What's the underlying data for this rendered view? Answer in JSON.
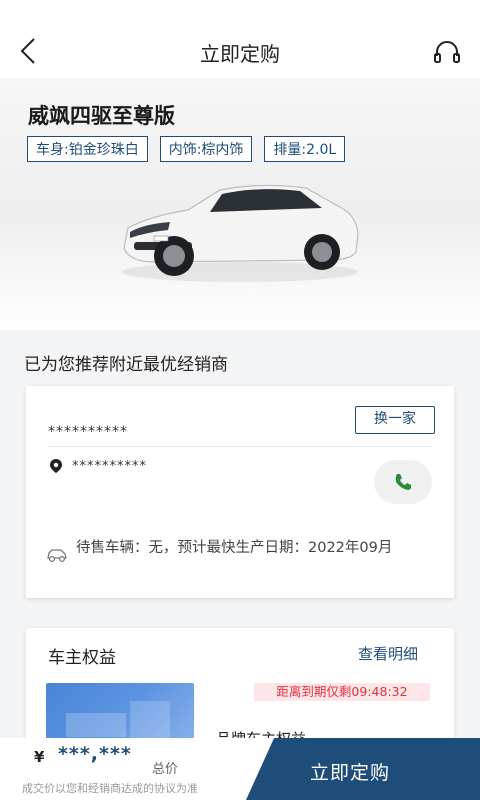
{
  "header": {
    "title": "立即定购",
    "back_icon": "chevron-left-icon",
    "support_icon": "headset-icon"
  },
  "car": {
    "model": "威飒四驱至尊版",
    "specs": [
      "车身:铂金珍珠白",
      "内饰:棕内饰",
      "排量:2.0L"
    ],
    "body_color": "#f4f4f4"
  },
  "dealer_section": {
    "title": "已为您推荐附近最优经销商",
    "switch_label": "换一家",
    "dealer_name": "**********",
    "dealer_address": "**********",
    "stock_text": "待售车辆：无，预计最快生产日期：2022年09月"
  },
  "benefits": {
    "title": "车主权益",
    "detail_link": "查看明细",
    "countdown": "距离到期仅剩09:48:32",
    "item_label": "品牌车主权益"
  },
  "footer": {
    "currency": "¥",
    "price": "***,***",
    "price_label": "总价",
    "note": "成交价以您和经销商达成的协议为准",
    "order_button": "立即定购"
  },
  "colors": {
    "brand": "#1f4d7a",
    "countdown_text": "#e0303e",
    "countdown_bg": "#fde6e8",
    "phone_icon": "#2e8b3a"
  }
}
